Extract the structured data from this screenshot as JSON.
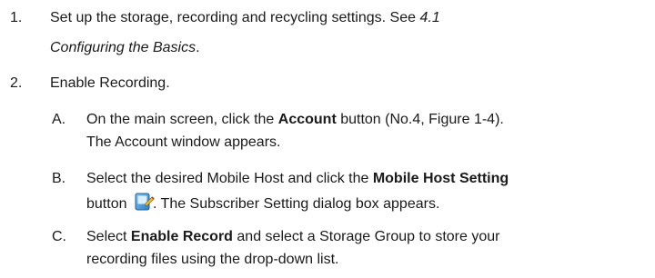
{
  "steps": [
    {
      "number": "1.",
      "line1_text": "Set up the storage, recording and recycling settings. See ",
      "line1_italic": "4.1",
      "line2_italic": "Configuring the Basics",
      "line2_tail": "."
    },
    {
      "number": "2.",
      "text": "Enable Recording.",
      "substeps": [
        {
          "letter": "A.",
          "line1_pre": "On the main screen, click the ",
          "line1_bold": "Account",
          "line1_post": " button (No.4, Figure 1-4).",
          "line2": "The Account window appears."
        },
        {
          "letter": "B.",
          "line1_pre": "Select the desired Mobile Host and click the ",
          "line1_bold": "Mobile Host Setting",
          "line2_pre": "button",
          "line2_icon": "mobile-host-setting-icon",
          "line2_post": ". The Subscriber Setting dialog box appears."
        },
        {
          "letter": "C.",
          "line1_pre": "Select ",
          "line1_bold": "Enable Record",
          "line1_post": " and select a Storage Group to store your",
          "line2": "recording files using the drop-down list."
        }
      ]
    }
  ]
}
